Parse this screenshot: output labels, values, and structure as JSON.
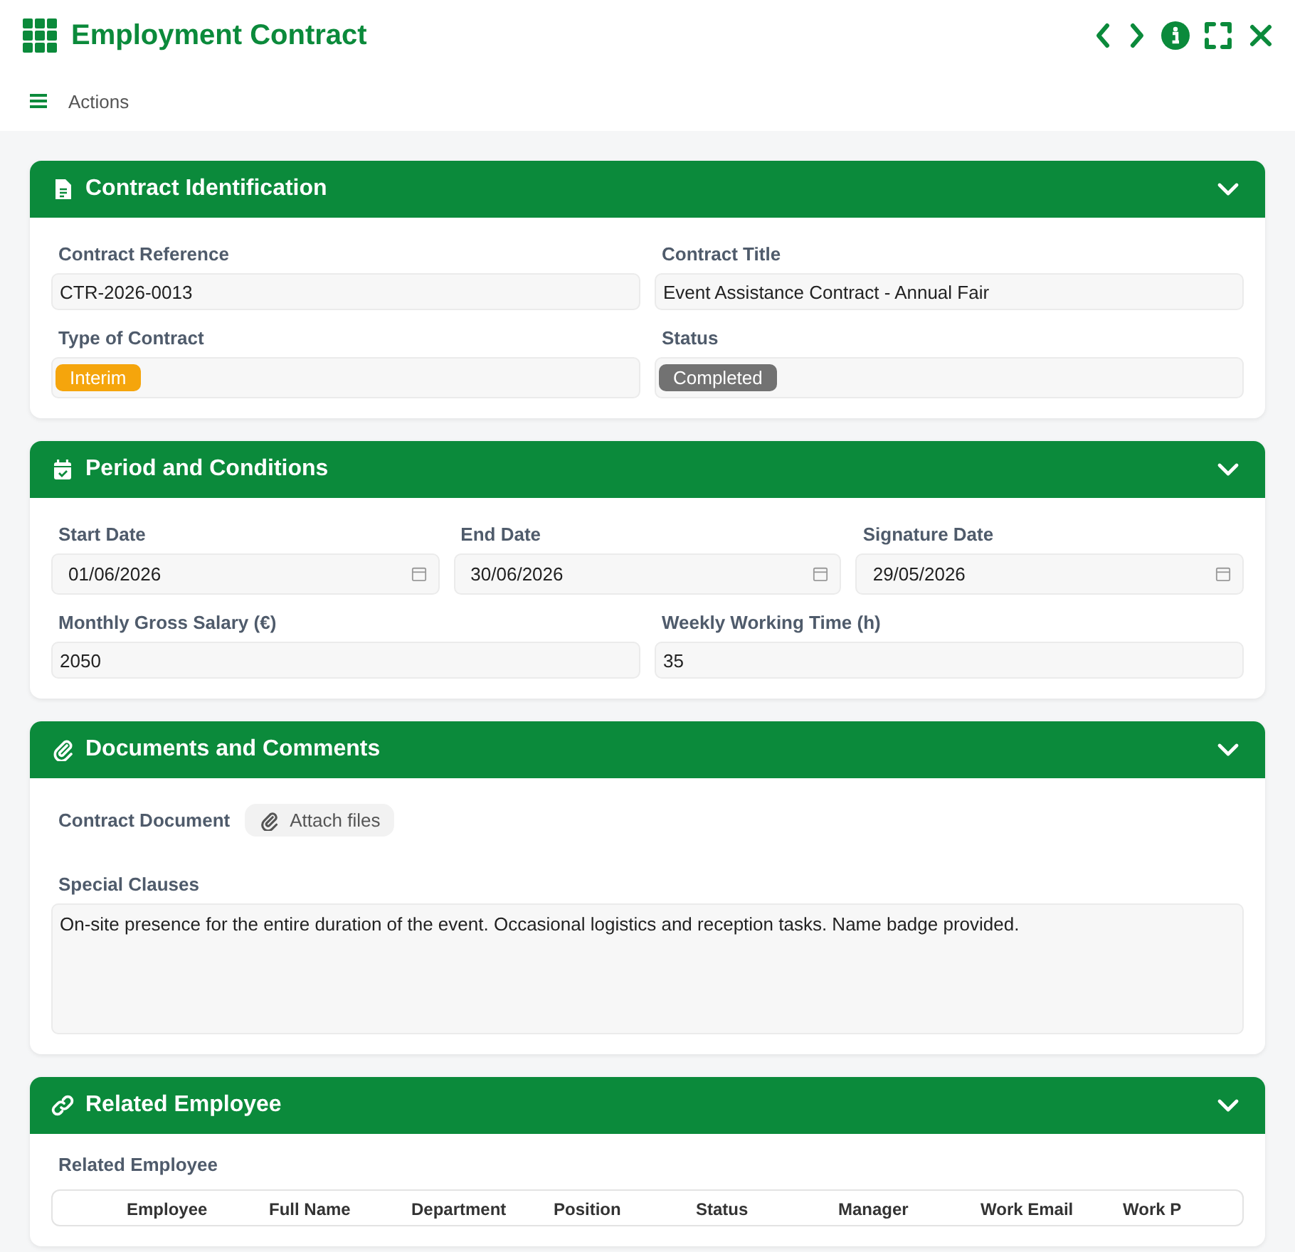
{
  "window": {
    "title": "Employment Contract"
  },
  "toolbar": {
    "label": "Actions"
  },
  "sections": [
    {
      "title": "Contract Identification",
      "expanded": true,
      "rows": [
        [
          {
            "kind": "text",
            "label": "Contract Reference",
            "value": "CTR-2026-0013"
          },
          {
            "kind": "text",
            "label": "Contract Title",
            "value": "Event Assistance Contract - Annual Fair"
          }
        ],
        [
          {
            "kind": "badge",
            "label": "Type of Contract",
            "value": "Interim",
            "color": "#f5a50c"
          },
          {
            "kind": "badge",
            "label": "Status",
            "value": "Completed",
            "color": "#727272"
          }
        ]
      ]
    },
    {
      "title": "Period and Conditions",
      "expanded": true,
      "rows": [
        [
          {
            "kind": "date",
            "label": "Start Date",
            "value": "01/06/2026"
          },
          {
            "kind": "date",
            "label": "End Date",
            "value": "30/06/2026"
          },
          {
            "kind": "date",
            "label": "Signature Date",
            "value": "29/05/2026"
          }
        ],
        [
          {
            "kind": "text",
            "label": "Monthly Gross Salary (€)",
            "value": "2050"
          },
          {
            "kind": "text",
            "label": "Weekly Working Time (h)",
            "value": "35"
          }
        ]
      ]
    },
    {
      "title": "Documents and Comments",
      "expanded": true,
      "rows": [
        [
          {
            "kind": "file",
            "label": "Contract Document",
            "value": "Attach files"
          }
        ],
        [
          {
            "kind": "textarea",
            "label": "Special Clauses",
            "value": "On-site presence for the entire duration of the event. Occasional logistics and reception tasks. Name badge provided."
          }
        ]
      ]
    },
    {
      "title": "Related Employee",
      "expanded": true,
      "rows": [
        [
          {
            "kind": "table",
            "label": "Related Employee",
            "columns": [
              "Employee",
              "Full Name",
              "Department",
              "Position",
              "Status",
              "Manager",
              "Work Email",
              "Work P"
            ]
          }
        ]
      ]
    }
  ]
}
